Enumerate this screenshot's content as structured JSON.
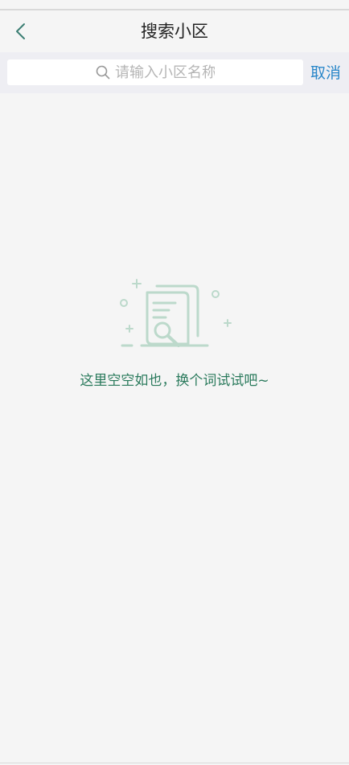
{
  "header": {
    "title": "搜索小区",
    "back_icon": "chevron-left-icon"
  },
  "search": {
    "placeholder": "请输入小区名称",
    "value": "",
    "icon": "search-icon",
    "cancel_label": "取消"
  },
  "empty_state": {
    "illustration": "document-search-icon",
    "message": "这里空空如也，换个词试试吧~"
  },
  "colors": {
    "background": "#f5f5f5",
    "search_bar_bg": "#eeeef3",
    "accent_link": "#2a87c9",
    "empty_text": "#2a7a5c",
    "illustration": "#bcd9cb",
    "back_icon": "#3d7f74"
  }
}
